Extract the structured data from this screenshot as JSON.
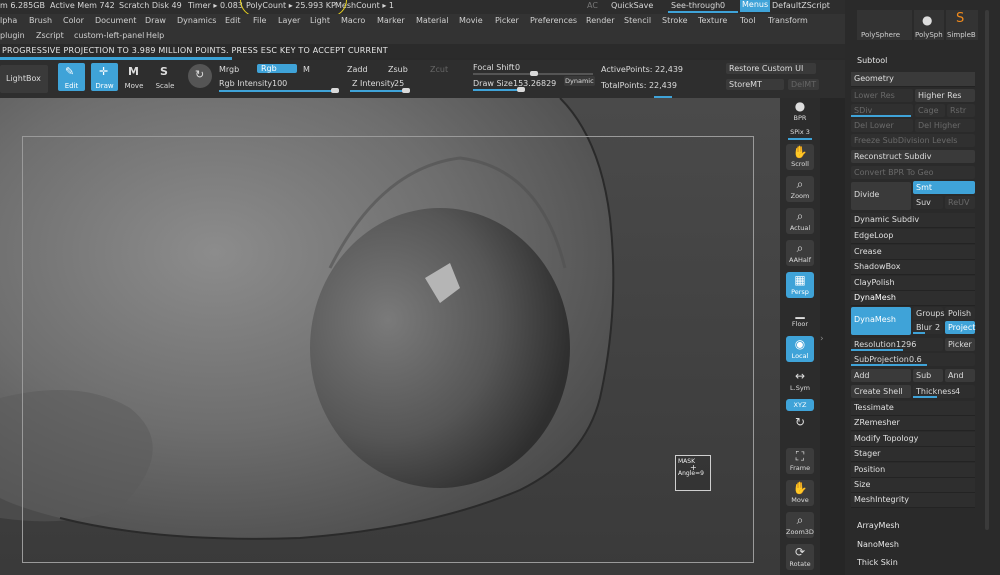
{
  "status": {
    "mem": "m 6.285GB",
    "active_mem": "Active Mem 742",
    "scratch": "Scratch Disk 49",
    "timer": "Timer ▸ 0.083",
    "polycount": "PolyCount ▸ 25.993 KP",
    "meshcount": "MeshCount ▸ 1",
    "ac": "AC",
    "quicksave": "QuickSave",
    "seethrough": "See-through",
    "seethrough_val": "0",
    "menus": "Menus",
    "script": "DefaultZScript"
  },
  "menu1": [
    "lpha",
    "Brush",
    "Color",
    "Document",
    "Draw",
    "Dynamics",
    "Edit",
    "File",
    "Layer",
    "Light",
    "Macro",
    "Marker",
    "Material",
    "Movie",
    "Picker",
    "Preferences",
    "Render",
    "Stencil",
    "Stroke",
    "Texture",
    "Tool",
    "Transform"
  ],
  "menu2": [
    "plugin",
    "Zscript",
    "custom-left-panel",
    "Help"
  ],
  "notice": "PROGRESSIVE PROJECTION TO 3.989 MILLION POINTS. PRESS ESC KEY TO ACCEPT CURRENT",
  "toolbar": {
    "lightbox": "LightBox",
    "edit": "Edit",
    "draw": "Draw",
    "move": "Move",
    "scale": "Scale",
    "mrgb": "Mrgb",
    "rgb": "Rgb",
    "m": "M",
    "rgb_intensity": "Rgb Intensity",
    "rgb_intensity_val": "100",
    "zadd": "Zadd",
    "zsub": "Zsub",
    "zcut": "Zcut",
    "z_intensity": "Z Intensity",
    "z_intensity_val": "25",
    "focal_shift": "Focal Shift",
    "focal_shift_val": "0",
    "draw_size": "Draw Size",
    "draw_size_val": "153.26829",
    "dynamic": "Dynamic",
    "active_points": "ActivePoints: 22,439",
    "total_points": "TotalPoints: 22,439",
    "restore_ui": "Restore Custom UI",
    "store_mt": "StoreMT",
    "del_mt": "DelMT"
  },
  "viewport": {
    "mask_label": "MASK",
    "angle_label": "Angle=9"
  },
  "iconstrip": [
    {
      "name": "bpr",
      "label": "BPR",
      "glyph": "●"
    },
    {
      "name": "spix",
      "label": "SPix 3",
      "glyph": ""
    },
    {
      "name": "scroll",
      "label": "Scroll",
      "glyph": "✋"
    },
    {
      "name": "zoom",
      "label": "Zoom",
      "glyph": "⌕"
    },
    {
      "name": "actual",
      "label": "Actual",
      "glyph": "⌕"
    },
    {
      "name": "aahalf",
      "label": "AAHalf",
      "glyph": "⌕"
    },
    {
      "name": "persp",
      "label": "Persp",
      "glyph": "▦"
    },
    {
      "name": "floor",
      "label": "Floor",
      "glyph": "▁"
    },
    {
      "name": "local",
      "label": "Local",
      "glyph": "◉"
    },
    {
      "name": "lsym",
      "label": "L.Sym",
      "glyph": "↔"
    },
    {
      "name": "xyz",
      "label": "XYZ",
      "glyph": ""
    },
    {
      "name": "rot1",
      "label": "",
      "glyph": "↻"
    },
    {
      "name": "frame",
      "label": "Frame",
      "glyph": "⛶"
    },
    {
      "name": "move",
      "label": "Move",
      "glyph": "✋"
    },
    {
      "name": "zoom3d",
      "label": "Zoom3D",
      "glyph": "⌕"
    },
    {
      "name": "rotate",
      "label": "Rotate",
      "glyph": "⟳"
    }
  ],
  "panel": {
    "polysphere": "PolySphere",
    "polysph": "PolySph",
    "simpleb": "SimpleB",
    "subtool": "Subtool",
    "geometry": "Geometry",
    "lower_res": "Lower Res",
    "higher_res": "Higher Res",
    "sdiv": "SDiv",
    "cage": "Cage",
    "rstr": "Rstr",
    "del_lower": "Del Lower",
    "del_higher": "Del Higher",
    "freeze": "Freeze SubDivision Levels",
    "reconstruct": "Reconstruct Subdiv",
    "convert_bpr": "Convert BPR To Geo",
    "divide": "Divide",
    "smt": "Smt",
    "suv": "Suv",
    "reuv": "ReUV",
    "dynamic_subdiv": "Dynamic Subdiv",
    "edgeloop": "EdgeLoop",
    "crease": "Crease",
    "shadowbox": "ShadowBox",
    "claypolish": "ClayPolish",
    "dynamesh_head": "DynaMesh",
    "dynamesh_btn": "DynaMesh",
    "groups": "Groups",
    "polish": "Polish",
    "blur": "Blur",
    "blur_val": "2",
    "project": "Project",
    "resolution": "Resolution",
    "resolution_val": "1296",
    "picker": "Picker",
    "subprojection": "SubProjection",
    "subprojection_val": "0.6",
    "add": "Add",
    "sub": "Sub",
    "and": "And",
    "create_shell": "Create Shell",
    "thickness": "Thickness",
    "thickness_val": "4",
    "tessimate": "Tessimate",
    "zremesher": "ZRemesher",
    "modify_topology": "Modify Topology",
    "stager": "Stager",
    "position": "Position",
    "size": "Size",
    "meshintegrity": "MeshIntegrity",
    "arraymesh": "ArrayMesh",
    "nanomesh": "NanoMesh",
    "thickskin": "Thick Skin"
  }
}
